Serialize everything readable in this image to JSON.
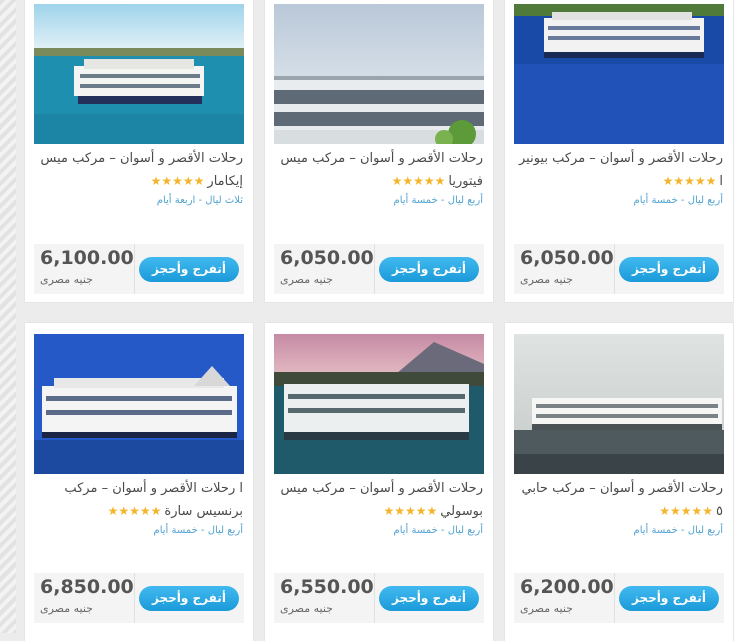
{
  "cards": [
    {
      "title": "رحلات الأقصر و أسوان – مركب ميس إيكامار",
      "stars": "★★★★★",
      "subtitle": "ثلاث ليال - اربعة أيام",
      "price": "6,100.00",
      "currency": "جنيه مصرى",
      "button": "أتفرج وأحجز",
      "image": "nile-cruise-ship-photo"
    },
    {
      "title": "رحلات الأقصر و أسوان – مركب ميس فيتوريا",
      "stars": "★★★★★",
      "subtitle": "أربع ليال - خمسة أيام",
      "price": "6,050.00",
      "currency": "جنيه مصرى",
      "button": "أتفرج وأحجز",
      "image": "nile-cruise-ship-photo"
    },
    {
      "title": "رحلات الأقصر و أسوان – مركب بيونير ا",
      "stars": "★★★★★",
      "subtitle": "أربع ليال - خمسة أيام",
      "price": "6,050.00",
      "currency": "جنيه مصرى",
      "button": "أتفرج وأحجز",
      "image": "nile-cruise-ship-photo"
    },
    {
      "title": "ا رحلات الأقصر و أسوان – مركب برنسيس سارة",
      "stars": "★★★★★",
      "subtitle": "أربع ليال - خمسة أيام",
      "price": "6,850.00",
      "currency": "جنيه مصرى",
      "button": "أتفرج وأحجز",
      "image": "nile-cruise-ship-photo"
    },
    {
      "title": "رحلات الأقصر و أسوان – مركب ميس بوسولي",
      "stars": "★★★★★",
      "subtitle": "أربع ليال - خمسة أيام",
      "price": "6,550.00",
      "currency": "جنيه مصرى",
      "button": "أتفرج وأحجز",
      "image": "nile-cruise-ship-photo"
    },
    {
      "title": "رحلات الأقصر و أسوان – مركب حابي ٥",
      "stars": "★★★★★",
      "subtitle": "أربع ليال - خمسة أيام",
      "price": "6,200.00",
      "currency": "جنيه مصرى",
      "button": "أتفرج وأحجز",
      "image": "nile-cruise-ship-photo"
    }
  ]
}
